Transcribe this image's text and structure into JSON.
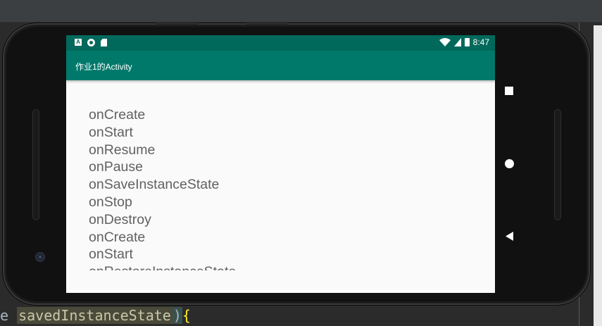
{
  "status_bar": {
    "time": "8:47",
    "left_icons": [
      "a-notification-icon",
      "circle-notification-icon",
      "sd-card-icon"
    ],
    "right_icons": [
      "wifi-icon",
      "signal-icon",
      "battery-icon"
    ]
  },
  "app_bar": {
    "title": "作业1的Activity",
    "color": "#00796b",
    "status_color": "#00695c"
  },
  "log": [
    "onCreate",
    "onStart",
    "onResume",
    "onPause",
    "onSaveInstanceState",
    "onStop",
    "onDestroy",
    "onCreate",
    "onStart",
    "onRestoreInstanceState"
  ],
  "nav": {
    "overview_icon": "square-icon",
    "home_icon": "circle-home-icon",
    "back_icon": "triangle-back-icon"
  },
  "ide": {
    "code_prefix": "e ",
    "code_highlighted": "savedInstanceState",
    "code_paren": ")",
    "code_brace": "{"
  }
}
